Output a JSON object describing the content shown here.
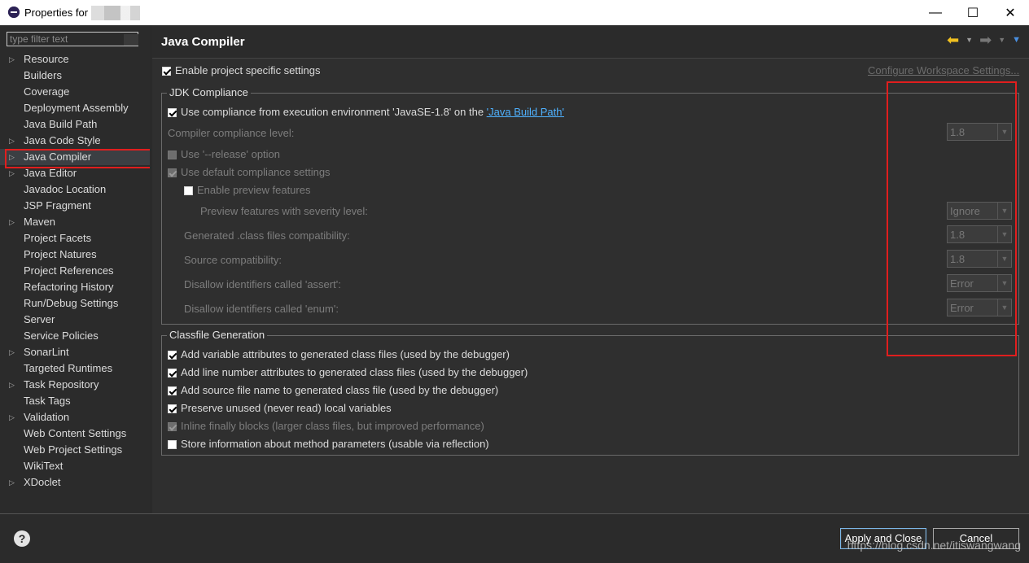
{
  "window": {
    "title": "Properties for",
    "minimize_label": "—",
    "maximize_label": "☐",
    "close_label": "✕"
  },
  "filter": {
    "placeholder": "type filter text"
  },
  "tree": [
    {
      "label": "Resource",
      "expandable": true
    },
    {
      "label": "Builders",
      "expandable": false
    },
    {
      "label": "Coverage",
      "expandable": false
    },
    {
      "label": "Deployment Assembly",
      "expandable": false
    },
    {
      "label": "Java Build Path",
      "expandable": false
    },
    {
      "label": "Java Code Style",
      "expandable": true
    },
    {
      "label": "Java Compiler",
      "expandable": true,
      "selected": true
    },
    {
      "label": "Java Editor",
      "expandable": true
    },
    {
      "label": "Javadoc Location",
      "expandable": false
    },
    {
      "label": "JSP Fragment",
      "expandable": false
    },
    {
      "label": "Maven",
      "expandable": true
    },
    {
      "label": "Project Facets",
      "expandable": false
    },
    {
      "label": "Project Natures",
      "expandable": false
    },
    {
      "label": "Project References",
      "expandable": false
    },
    {
      "label": "Refactoring History",
      "expandable": false
    },
    {
      "label": "Run/Debug Settings",
      "expandable": false
    },
    {
      "label": "Server",
      "expandable": false
    },
    {
      "label": "Service Policies",
      "expandable": false
    },
    {
      "label": "SonarLint",
      "expandable": true
    },
    {
      "label": "Targeted Runtimes",
      "expandable": false
    },
    {
      "label": "Task Repository",
      "expandable": true
    },
    {
      "label": "Task Tags",
      "expandable": false
    },
    {
      "label": "Validation",
      "expandable": true
    },
    {
      "label": "Web Content Settings",
      "expandable": false
    },
    {
      "label": "Web Project Settings",
      "expandable": false
    },
    {
      "label": "WikiText",
      "expandable": false
    },
    {
      "label": "XDoclet",
      "expandable": true
    }
  ],
  "page": {
    "title": "Java Compiler",
    "enable_project_specific": "Enable project specific settings",
    "configure_workspace": "Configure Workspace Settings..."
  },
  "jdk": {
    "group_title": "JDK Compliance",
    "use_compliance_prefix": "Use compliance from execution environment 'JavaSE-1.8' on the ",
    "java_build_path_link": "'Java Build Path'",
    "compiler_level_label": "Compiler compliance level:",
    "compiler_level_value": "1.8",
    "use_release": "Use '--release' option",
    "use_default": "Use default compliance settings",
    "enable_preview": "Enable preview features",
    "preview_severity_label": "Preview features with severity level:",
    "preview_severity_value": "Ignore",
    "generated_label": "Generated .class files compatibility:",
    "generated_value": "1.8",
    "source_label": "Source compatibility:",
    "source_value": "1.8",
    "assert_label": "Disallow identifiers called 'assert':",
    "assert_value": "Error",
    "enum_label": "Disallow identifiers called 'enum':",
    "enum_value": "Error"
  },
  "classfile": {
    "group_title": "Classfile Generation",
    "opt1": "Add variable attributes to generated class files (used by the debugger)",
    "opt2": "Add line number attributes to generated class files (used by the debugger)",
    "opt3": "Add source file name to generated class file (used by the debugger)",
    "opt4": "Preserve unused (never read) local variables",
    "opt5": "Inline finally blocks (larger class files, but improved performance)",
    "opt6": "Store information about method parameters (usable via reflection)"
  },
  "footer": {
    "help_label": "?",
    "apply_close": "Apply and Close",
    "cancel": "Cancel",
    "watermark": "https://blog.csdn.net/itiswangwang"
  },
  "colors": {
    "highlight_red": "#e01e1e",
    "link_blue": "#4fb2ff",
    "nav_arrow_yellow": "#f0c020"
  }
}
